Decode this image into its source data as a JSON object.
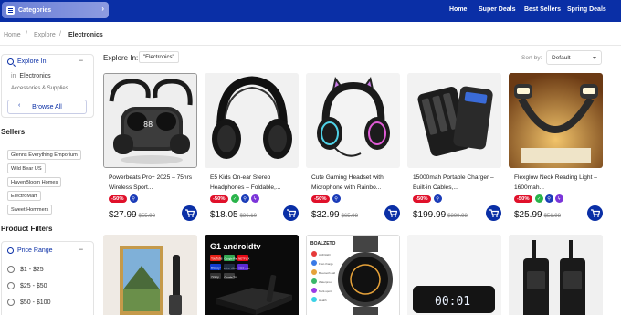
{
  "topnav": {
    "categories_label": "Categories",
    "links": [
      "Home",
      "Super Deals",
      "Best Sellers",
      "Spring Deals"
    ]
  },
  "breadcrumb": [
    "Home",
    "Explore",
    "Electronics"
  ],
  "sidebar": {
    "explore_title": "Explore In",
    "current_prefix": "in",
    "current_category": "Electronics",
    "subcategory": "Accessories & Supplies",
    "browse_all": "Browse All",
    "sellers_title": "Sellers",
    "sellers": [
      "Glenns Everything Emporium",
      "Wild Bear US",
      "HavenBloom Homes",
      "ElectroMart",
      "Sweet Hommers"
    ],
    "filters_title": "Product Filters",
    "price_range_title": "Price Range",
    "price_options": [
      "$1 - $25",
      "$25 - $50",
      "$50 - $100"
    ]
  },
  "main": {
    "explore_in_label": "Explore In:",
    "search_term": "\"Electronics\"",
    "sort_label": "Sort by:",
    "sort_value": "Default"
  },
  "products": [
    {
      "title": "Powerbeats Pro+ 2025 – 75hrs Wireless Sport...",
      "discount": "-50%",
      "price": "$27.99",
      "old_price": "$55.98",
      "badges": [
        "blue"
      ]
    },
    {
      "title": "E5 Kids On-ear Stereo Headphones – Foldable,...",
      "discount": "-50%",
      "price": "$18.05",
      "old_price": "$36.10",
      "badges": [
        "green",
        "blue",
        "purple"
      ]
    },
    {
      "title": "Cute Gaming Headset with Microphone with Rainbo...",
      "discount": "-50%",
      "price": "$32.99",
      "old_price": "$65.98",
      "badges": [
        "blue"
      ]
    },
    {
      "title": "15000mah Portable Charger – Built-in Cables,...",
      "discount": "-50%",
      "price": "$199.99",
      "old_price": "$399.98",
      "badges": [
        "blue"
      ]
    },
    {
      "title": "Flexglow Neck Reading Light – 1600mah...",
      "discount": "-50%",
      "price": "$25.99",
      "old_price": "$51.98",
      "badges": [
        "green",
        "blue",
        "purple"
      ]
    }
  ],
  "second_row": {
    "android_brand": "G1 androidtv",
    "tv_apps": [
      "YouTube",
      "Google Play",
      "NETFLIX",
      "Disney+",
      "prime video",
      "HBO max",
      "Dolby",
      "Google TV"
    ],
    "watch_brand": "BOALZETO",
    "watch_features": [
      "AMOLED",
      "Fast charge",
      "Bluetooth call",
      "Waterproof",
      "Multi-sport",
      "Health"
    ],
    "clock_time": "00:01"
  },
  "colors": {
    "nav": "#0a2fa6",
    "discount": "#e0102a",
    "accent": "#0a2fa6"
  }
}
